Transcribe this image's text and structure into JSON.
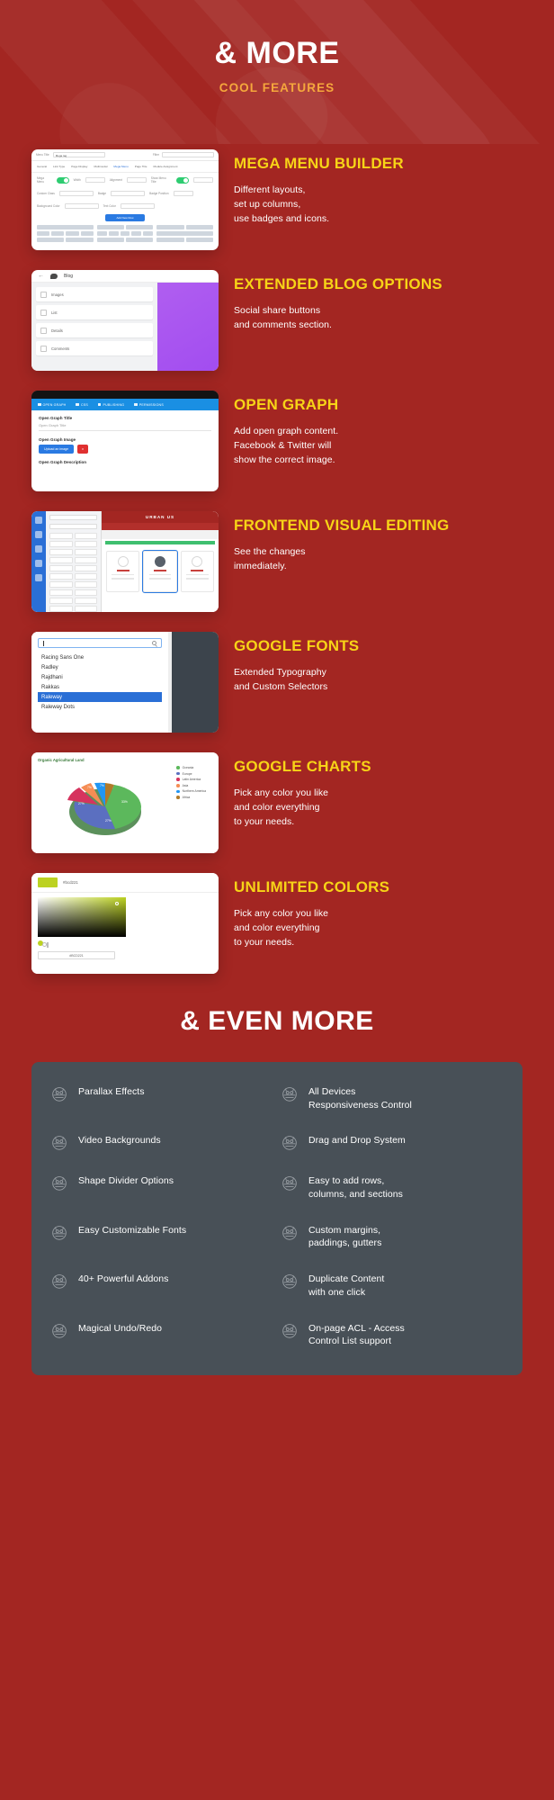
{
  "hero": {
    "title": "& MORE",
    "subtitle": "COOL FEATURES"
  },
  "colors": {
    "background": "#a32622",
    "accent_yellow": "#f7d417",
    "accent_orange": "#f5a73c",
    "panel": "#485057",
    "white": "#ffffff"
  },
  "features": [
    {
      "title": "MEGA MENU BUILDER",
      "desc": "Different layouts,\nset up columns,\nuse badges and icons.",
      "shot": {
        "kind": "mega-menu-builder",
        "menu_title_label": "Menu Title",
        "menu_title_value": "Mega tag",
        "filter_label": "Filter",
        "tabs": [
          "General",
          "Link Type",
          "Page Display",
          "Multimodal",
          "Mega Menu",
          "Page Title",
          "Module Assignment"
        ],
        "active_tab": "Mega Menu",
        "fields": [
          {
            "label": "Mega Menu",
            "type": "toggle",
            "value": "on"
          },
          {
            "label": "Width",
            "type": "select",
            "value": "auto"
          },
          {
            "label": "Alignment",
            "type": "select",
            "value": "Right"
          },
          {
            "label": "Show Menu Title",
            "type": "toggle",
            "value": "on"
          },
          {
            "label": "Icon",
            "type": "select",
            "value": "Select"
          },
          {
            "label": "Custom Class",
            "type": "input",
            "value": ""
          },
          {
            "label": "Badge",
            "type": "input",
            "value": ""
          },
          {
            "label": "Badge Position",
            "type": "select",
            "value": "Left"
          },
          {
            "label": "Background Color",
            "type": "color",
            "value": "#ffffff"
          },
          {
            "label": "Text Color",
            "type": "color",
            "value": "#ffffff"
          }
        ],
        "button_label": "Add New Row"
      }
    },
    {
      "title": "EXTENDED BLOG OPTIONS",
      "desc": "Social share buttons\nand comments section.",
      "shot": {
        "kind": "blog-options",
        "header_title": "Blog",
        "items": [
          "Images",
          "List",
          "Details",
          "Comments"
        ],
        "preview_color": "#a855f7"
      }
    },
    {
      "title": "OPEN GRAPH",
      "desc": "Add open graph content.\nFacebook & Twitter will\nshow the correct image.",
      "shot": {
        "kind": "open-graph",
        "tabs": [
          "OPEN GRAPH",
          "CSS",
          "PUBLISHING",
          "PERMISSIONS"
        ],
        "active_tab": "OPEN GRAPH",
        "fields": [
          {
            "label": "Open Graph Title",
            "placeholder": "Open Graph Title"
          },
          {
            "label": "Open Graph Image",
            "upload_label": "Upload an image",
            "delete_label": "x"
          },
          {
            "label": "Open Graph Description",
            "placeholder": ""
          }
        ]
      }
    },
    {
      "title": "FRONTEND VISUAL EDITING",
      "desc": "See the changes\nimmediately.",
      "shot": {
        "kind": "frontend-editing",
        "brand": "URBAN US",
        "panel_search_placeholder": "Search"
      }
    },
    {
      "title": "GOOGLE FONTS",
      "desc": "Extended Typography\nand Custom Selectors",
      "shot": {
        "kind": "google-fonts",
        "search_value": "",
        "options": [
          "Racing Sans One",
          "Radley",
          "Rajdhani",
          "Rakkas",
          "Raleway",
          "Raleway Dots"
        ],
        "selected": "Raleway"
      }
    },
    {
      "title": "GOOGLE CHARTS",
      "desc": "Pick any color you like\nand color everything\nto your needs.",
      "shot": {
        "kind": "google-charts",
        "chart_title": "Organic Agricultural Land"
      }
    },
    {
      "title": "UNLIMITED COLORS",
      "desc": "Pick any color you like\nand color everything\nto your needs.",
      "shot": {
        "kind": "unlimited-colors",
        "hex_top": "#bcd221",
        "hex_input": "#BCD221",
        "swatch_color": "#bcd221"
      }
    }
  ],
  "chart_data": {
    "type": "pie",
    "title": "Organic Agricultural Land",
    "categories": [
      "Oceania",
      "Europe",
      "Latin America",
      "Asia",
      "Northern America",
      "Africa"
    ],
    "values": [
      33,
      27,
      27,
      7,
      7,
      3
    ],
    "value_labels": [
      "33%",
      "27%",
      "27%",
      "7%",
      "7%",
      ""
    ],
    "colors": [
      "#5cb85c",
      "#5b6fc0",
      "#d6335e",
      "#f58d54",
      "#2196f3",
      "#b07a2a"
    ],
    "legend_position": "right",
    "xlabel": "",
    "ylabel": ""
  },
  "even_more": {
    "heading": "& EVEN MORE"
  },
  "panel_features": [
    {
      "icon": "owl-badge-icon",
      "label": "Parallax Effects"
    },
    {
      "icon": "owl-badge-icon",
      "label": "All Devices\nResponsiveness Control"
    },
    {
      "icon": "owl-badge-icon",
      "label": "Video Backgrounds"
    },
    {
      "icon": "owl-badge-icon",
      "label": "Drag and Drop System"
    },
    {
      "icon": "owl-badge-icon",
      "label": "Shape Divider Options"
    },
    {
      "icon": "owl-badge-icon",
      "label": "Easy to add rows,\ncolumns, and sections"
    },
    {
      "icon": "owl-badge-icon",
      "label": "Easy Customizable Fonts"
    },
    {
      "icon": "owl-badge-icon",
      "label": "Custom margins,\npaddings, gutters"
    },
    {
      "icon": "owl-badge-icon",
      "label": "40+ Powerful Addons"
    },
    {
      "icon": "owl-badge-icon",
      "label": "Duplicate Content\nwith one click"
    },
    {
      "icon": "owl-badge-icon",
      "label": "Magical Undo/Redo"
    },
    {
      "icon": "owl-badge-icon",
      "label": "On-page ACL - Access\nControl List support"
    }
  ]
}
